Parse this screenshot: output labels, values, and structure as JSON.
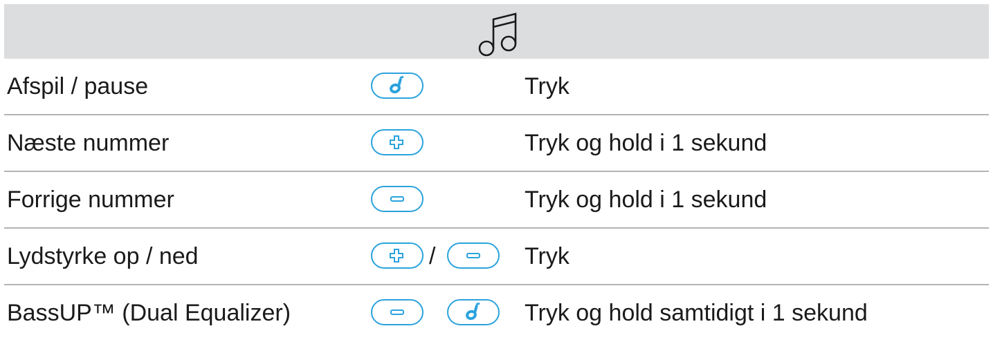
{
  "header": {
    "icon": "music-notes-icon"
  },
  "colors": {
    "header_bg": "#dcdddf",
    "button_accent": "#2aa3dd",
    "divider": "#b3b3b3"
  },
  "rows": [
    {
      "label": "Afspil / pause",
      "buttons": [
        "play-icon"
      ],
      "action": "Tryk"
    },
    {
      "label": "Næste nummer",
      "buttons": [
        "plus-icon"
      ],
      "action": "Tryk og hold i 1 sekund"
    },
    {
      "label": "Forrige nummer",
      "buttons": [
        "minus-icon"
      ],
      "action": "Tryk og hold i 1 sekund"
    },
    {
      "label": "Lydstyrke op / ned",
      "buttons": [
        "plus-icon",
        "minus-icon"
      ],
      "separator": "/",
      "action": "Tryk"
    },
    {
      "label": "BassUP™ (Dual Equalizer)",
      "buttons": [
        "minus-icon",
        "play-icon"
      ],
      "action": "Tryk og hold samtidigt i 1 sekund"
    }
  ]
}
